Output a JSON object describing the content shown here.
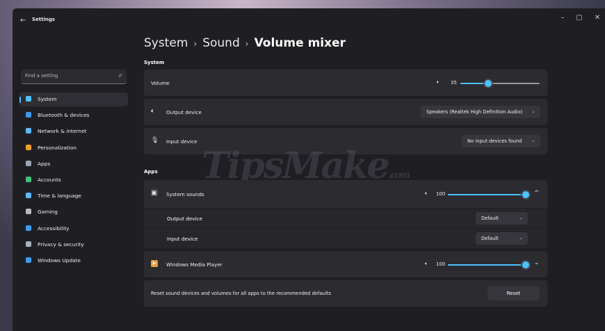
{
  "window": {
    "title": "Settings",
    "back_glyph": "←",
    "controls": {
      "minimize": "–",
      "maximize": "▢",
      "close": "✕"
    }
  },
  "sidebar": {
    "search_placeholder": "Find a setting",
    "search_icon": "search-icon",
    "items": [
      {
        "label": "System",
        "icon": "system-icon",
        "color": "#4cc2ff",
        "selected": true
      },
      {
        "label": "Bluetooth & devices",
        "icon": "bluetooth-icon",
        "color": "#3a9cf0"
      },
      {
        "label": "Network & internet",
        "icon": "network-icon",
        "color": "#5fb8f5"
      },
      {
        "label": "Personalization",
        "icon": "brush-icon",
        "color": "#f0a030"
      },
      {
        "label": "Apps",
        "icon": "apps-icon",
        "color": "#9aa6b8"
      },
      {
        "label": "Accounts",
        "icon": "accounts-icon",
        "color": "#3cc47c"
      },
      {
        "label": "Time & language",
        "icon": "globe-icon",
        "color": "#5fb8f5"
      },
      {
        "label": "Gaming",
        "icon": "gaming-icon",
        "color": "#bbbbbb"
      },
      {
        "label": "Accessibility",
        "icon": "accessibility-icon",
        "color": "#3a9cf0"
      },
      {
        "label": "Privacy & security",
        "icon": "shield-icon",
        "color": "#aab0bc"
      },
      {
        "label": "Windows Update",
        "icon": "update-icon",
        "color": "#3a9cf0"
      }
    ]
  },
  "breadcrumb": {
    "part1": "System",
    "part2": "Sound",
    "current": "Volume mixer",
    "separator": "›"
  },
  "system_section": {
    "title": "System",
    "volume": {
      "label": "Volume",
      "value": "35",
      "level": 0.35,
      "icon": "speaker-icon"
    },
    "output": {
      "label": "Output device",
      "value": "Speakers (Realtek High Definition Audio)",
      "icon": "speaker-icon"
    },
    "input": {
      "label": "Input device",
      "value": "No input devices found",
      "icon": "microphone-icon"
    }
  },
  "apps_section": {
    "title": "Apps",
    "system_sounds": {
      "label": "System sounds",
      "value": "100",
      "level": 1.0,
      "output_label": "Output device",
      "output_value": "Default",
      "input_label": "Input device",
      "input_value": "Default"
    },
    "media_player": {
      "label": "Windows Media Player",
      "value": "100",
      "level": 1.0
    }
  },
  "reset": {
    "text": "Reset sound devices and volumes for all apps to the recommended defaults",
    "button": "Reset"
  },
  "watermark": {
    "main": "TipsMake",
    "suffix": ".com"
  },
  "accent": "#4cc2ff",
  "glyphs": {
    "chevron_down": "⌄",
    "chevron_up": "^",
    "speaker": "🔈︎",
    "mic": "🎙︎"
  }
}
